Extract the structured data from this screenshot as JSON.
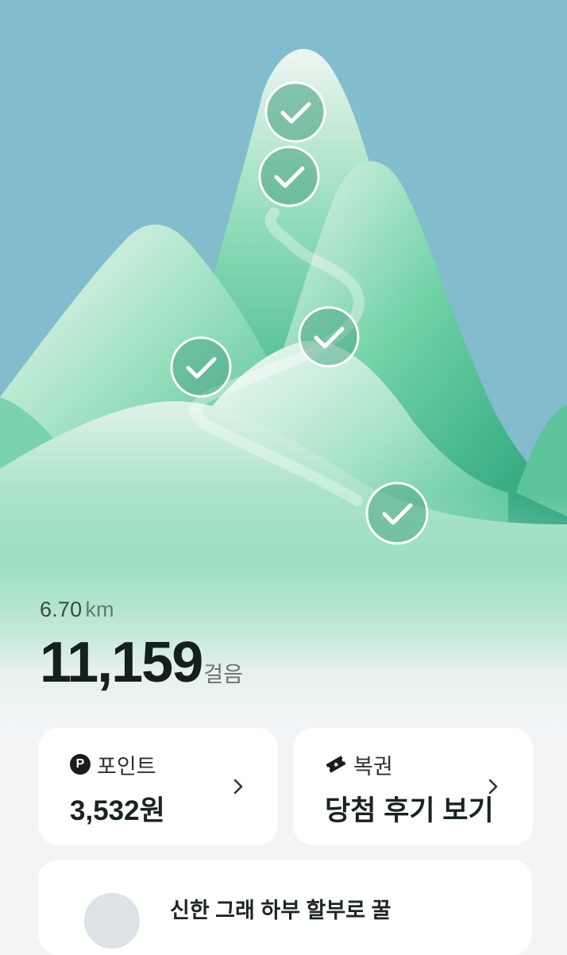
{
  "distance": {
    "value": "6.70",
    "unit": "km"
  },
  "steps": {
    "count": "11,159",
    "unit": "걸음"
  },
  "points_card": {
    "badge": "P",
    "label": "포인트",
    "value": "3,532원"
  },
  "lottery_card": {
    "label": "복권",
    "value": "당첨 후기 보기"
  },
  "promo_card": {
    "text": "신한 그래 하부 할부로 꿀"
  },
  "checkpoints": [
    "checked",
    "checked",
    "checked",
    "checked",
    "checked"
  ],
  "colors": {
    "sky": "#82bccd",
    "mountain": "#3fbf8e",
    "text_dark": "#14201c"
  }
}
